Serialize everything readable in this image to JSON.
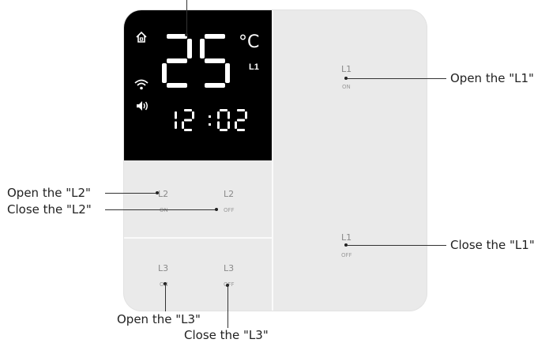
{
  "display": {
    "temperature": "25",
    "temperature_unit": "°C",
    "zone_tag": "L1",
    "clock": "12:02",
    "icons": [
      "home-icon",
      "wifi-icon",
      "speaker-icon"
    ]
  },
  "keys": {
    "l1_on": {
      "name": "L1",
      "state": "ON"
    },
    "l1_off": {
      "name": "L1",
      "state": "OFF"
    },
    "l2_on": {
      "name": "L2",
      "state": "ON"
    },
    "l2_off": {
      "name": "L2",
      "state": "OFF"
    },
    "l3_on": {
      "name": "L3",
      "state": "ON"
    },
    "l3_off": {
      "name": "L3",
      "state": "OFF"
    }
  },
  "callouts": {
    "open_l1": "Open the \"L1\"",
    "close_l1": "Close the \"L1\"",
    "open_l2": "Open the \"L2\"",
    "close_l2": "Close the \"L2\"",
    "open_l3": "Open the \"L3\"",
    "close_l3": "Close the \"L3\""
  },
  "colors": {
    "panel": "#eaeaea",
    "display_bg": "#000000",
    "display_fg": "#ffffff",
    "key_text": "#8a8a8a"
  }
}
